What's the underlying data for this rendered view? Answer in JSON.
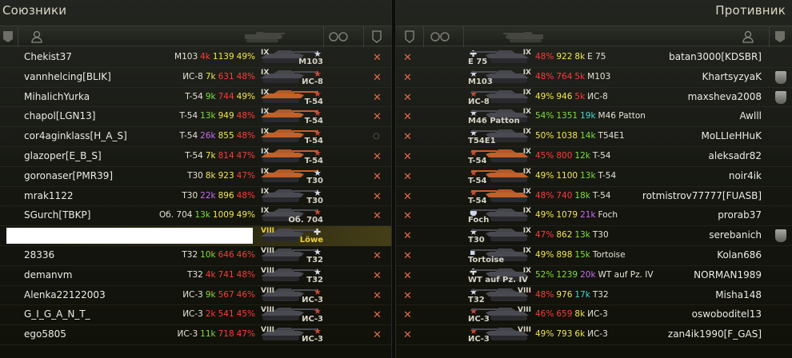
{
  "allies": {
    "title": "Союзники",
    "rows": [
      {
        "player": "Chekist37",
        "vehicle": "M103",
        "battles": "4k",
        "battles_color": "#ff3a3a",
        "rating": "1139",
        "rating_color": "#f2e84a",
        "winrate": "49%",
        "winrate_color": "#f2e84a",
        "tier": "IX",
        "nation": "usa",
        "tank_label": "M103",
        "status": "dead",
        "tank_color": "#4a4a52"
      },
      {
        "player": "vannhelcing[BLIK]",
        "vehicle": "ИС-8",
        "battles": "7k",
        "battles_color": "#f2e84a",
        "rating": "631",
        "rating_color": "#ff3a3a",
        "winrate": "48%",
        "winrate_color": "#ff3a3a",
        "tier": "IX",
        "nation": "ussr",
        "tank_label": "ИС-8",
        "status": "dead",
        "tank_color": "#4a4a52"
      },
      {
        "player": "MihalichYurka",
        "vehicle": "T-54",
        "battles": "9k",
        "battles_color": "#7dde3c",
        "rating": "744",
        "rating_color": "#ff3a3a",
        "winrate": "49%",
        "winrate_color": "#f2e84a",
        "tier": "IX",
        "nation": "ussr",
        "tank_label": "T-54",
        "status": "dead",
        "tank_color": "#c0622a"
      },
      {
        "player": "chapol[LGN13]",
        "vehicle": "T-54",
        "battles": "13k",
        "battles_color": "#7dde3c",
        "rating": "949",
        "rating_color": "#f2e84a",
        "winrate": "48%",
        "winrate_color": "#ff3a3a",
        "tier": "IX",
        "nation": "ussr",
        "tank_label": "T-54",
        "status": "dead",
        "tank_color": "#c0622a"
      },
      {
        "player": "cor4aginklass[H_A_S]",
        "vehicle": "T-54",
        "battles": "26k",
        "battles_color": "#c46bf0",
        "rating": "855",
        "rating_color": "#f2e84a",
        "winrate": "48%",
        "winrate_color": "#ff3a3a",
        "tier": "IX",
        "nation": "ussr",
        "tank_label": "T-54",
        "status": "alive",
        "tank_color": "#c0622a"
      },
      {
        "player": "glazoper[E_B_S]",
        "vehicle": "T-54",
        "battles": "7k",
        "battles_color": "#f2e84a",
        "rating": "814",
        "rating_color": "#ff3a3a",
        "winrate": "47%",
        "winrate_color": "#ff3a3a",
        "tier": "IX",
        "nation": "ussr",
        "tank_label": "T-54",
        "status": "dead",
        "tank_color": "#c0622a"
      },
      {
        "player": "goronaser[PMR39]",
        "vehicle": "T30",
        "battles": "8k",
        "battles_color": "#f2e84a",
        "rating": "923",
        "rating_color": "#f2e84a",
        "winrate": "47%",
        "winrate_color": "#ff3a3a",
        "tier": "IX",
        "nation": "usa",
        "tank_label": "T30",
        "status": "dead",
        "tank_color": "#c0622a"
      },
      {
        "player": "mrak1122",
        "vehicle": "T30",
        "battles": "22k",
        "battles_color": "#c46bf0",
        "rating": "896",
        "rating_color": "#f2e84a",
        "winrate": "48%",
        "winrate_color": "#ff3a3a",
        "tier": "IX",
        "nation": "usa",
        "tank_label": "T30",
        "status": "dead",
        "tank_color": "#4a4a52"
      },
      {
        "player": "SGurch[TBKP]",
        "vehicle": "Об. 704",
        "battles": "13k",
        "battles_color": "#7dde3c",
        "rating": "1009",
        "rating_color": "#f2e84a",
        "winrate": "49%",
        "winrate_color": "#f2e84a",
        "tier": "IX",
        "nation": "ussr",
        "tank_label": "Об. 704",
        "status": "dead",
        "tank_color": "#4a4a52"
      },
      {
        "player": "",
        "vehicle": "",
        "battles": "",
        "battles_color": "#f2e84a",
        "rating": "",
        "rating_color": "#f2e84a",
        "winrate": "",
        "winrate_color": "#f2e84a",
        "tier": "VIII",
        "nation": "germany",
        "tank_label": "Löwe",
        "status": "none",
        "tank_color": "#4a4a52",
        "self": true
      },
      {
        "player": "28336",
        "vehicle": "T32",
        "battles": "10k",
        "battles_color": "#7dde3c",
        "rating": "646",
        "rating_color": "#ff3a3a",
        "winrate": "46%",
        "winrate_color": "#ff3a3a",
        "tier": "VIII",
        "nation": "usa",
        "tank_label": "T32",
        "status": "dead",
        "tank_color": "#4a4a52"
      },
      {
        "player": "demanvm",
        "vehicle": "T32",
        "battles": "4k",
        "battles_color": "#ff3a3a",
        "rating": "741",
        "rating_color": "#ff3a3a",
        "winrate": "48%",
        "winrate_color": "#ff3a3a",
        "tier": "VIII",
        "nation": "usa",
        "tank_label": "T32",
        "status": "dead",
        "tank_color": "#4a4a52"
      },
      {
        "player": "Alenka22122003",
        "vehicle": "ИС-3",
        "battles": "9k",
        "battles_color": "#7dde3c",
        "rating": "567",
        "rating_color": "#ff3a3a",
        "winrate": "46%",
        "winrate_color": "#ff3a3a",
        "tier": "VIII",
        "nation": "ussr",
        "tank_label": "ИС-3",
        "status": "dead",
        "tank_color": "#4a4a52"
      },
      {
        "player": "G_I_G_A_N_T_",
        "vehicle": "ИС-3",
        "battles": "2k",
        "battles_color": "#ff3a3a",
        "rating": "541",
        "rating_color": "#ff3a3a",
        "winrate": "45%",
        "winrate_color": "#ff3a3a",
        "tier": "VIII",
        "nation": "ussr",
        "tank_label": "ИС-3",
        "status": "dead",
        "tank_color": "#4a4a52"
      },
      {
        "player": "ego5805",
        "vehicle": "ИС-3",
        "battles": "11k",
        "battles_color": "#7dde3c",
        "rating": "718",
        "rating_color": "#ff3a3a",
        "winrate": "47%",
        "winrate_color": "#ff3a3a",
        "tier": "VIII",
        "nation": "ussr",
        "tank_label": "ИС-3",
        "status": "dead",
        "tank_color": "#4a4a52"
      }
    ]
  },
  "enemies": {
    "title": "Противник",
    "rows": [
      {
        "player": "batan3000[KDSBR]",
        "vehicle": "E 75",
        "battles": "8k",
        "battles_color": "#f2e84a",
        "rating": "922",
        "rating_color": "#f2e84a",
        "winrate": "48%",
        "winrate_color": "#ff3a3a",
        "tier": "IX",
        "nation": "germany",
        "tank_label": "E 75",
        "status": "dead",
        "badge": false,
        "tank_color": "#4a4a52"
      },
      {
        "player": "KhartsyzyaK",
        "vehicle": "M103",
        "battles": "5k",
        "battles_color": "#ff3a3a",
        "rating": "764",
        "rating_color": "#ff3a3a",
        "winrate": "48%",
        "winrate_color": "#ff3a3a",
        "tier": "IX",
        "nation": "usa",
        "tank_label": "M103",
        "status": "dead",
        "badge": true,
        "tank_color": "#4a4a52"
      },
      {
        "player": "maxsheva2008",
        "vehicle": "ИС-8",
        "battles": "5k",
        "battles_color": "#ff3a3a",
        "rating": "946",
        "rating_color": "#f2e84a",
        "winrate": "49%",
        "winrate_color": "#f2e84a",
        "tier": "IX",
        "nation": "ussr",
        "tank_label": "ИС-8",
        "status": "dead",
        "badge": true,
        "tank_color": "#4a4a52"
      },
      {
        "player": "Awlll",
        "vehicle": "M46 Patton",
        "battles": "19k",
        "battles_color": "#46d6d0",
        "rating": "1351",
        "rating_color": "#7dde3c",
        "winrate": "54%",
        "winrate_color": "#7dde3c",
        "tier": "IX",
        "nation": "usa",
        "tank_label": "M46 Patton",
        "status": "dead",
        "badge": false,
        "tank_color": "#4a4a52"
      },
      {
        "player": "MoLLIeHHuK",
        "vehicle": "T54E1",
        "battles": "14k",
        "battles_color": "#7dde3c",
        "rating": "1038",
        "rating_color": "#f2e84a",
        "winrate": "50%",
        "winrate_color": "#f2e84a",
        "tier": "IX",
        "nation": "usa",
        "tank_label": "T54E1",
        "status": "dead",
        "badge": false,
        "tank_color": "#4a4a52"
      },
      {
        "player": "aleksadr82",
        "vehicle": "T-54",
        "battles": "12k",
        "battles_color": "#7dde3c",
        "rating": "800",
        "rating_color": "#ff3a3a",
        "winrate": "45%",
        "winrate_color": "#ff3a3a",
        "tier": "IX",
        "nation": "ussr",
        "tank_label": "T-54",
        "status": "dead",
        "badge": false,
        "tank_color": "#c0622a"
      },
      {
        "player": "noir4ik",
        "vehicle": "T-54",
        "battles": "13k",
        "battles_color": "#7dde3c",
        "rating": "1100",
        "rating_color": "#f2e84a",
        "winrate": "49%",
        "winrate_color": "#f2e84a",
        "tier": "IX",
        "nation": "ussr",
        "tank_label": "T-54",
        "status": "dead",
        "badge": false,
        "tank_color": "#c0622a"
      },
      {
        "player": "rotmistrov77777[FUASB]",
        "vehicle": "T-54",
        "battles": "18k",
        "battles_color": "#7dde3c",
        "rating": "740",
        "rating_color": "#ff3a3a",
        "winrate": "48%",
        "winrate_color": "#ff3a3a",
        "tier": "IX",
        "nation": "ussr",
        "tank_label": "T-54",
        "status": "dead",
        "badge": false,
        "tank_color": "#c0622a"
      },
      {
        "player": "prorab37",
        "vehicle": "Foch",
        "battles": "21k",
        "battles_color": "#c46bf0",
        "rating": "1079",
        "rating_color": "#f2e84a",
        "winrate": "49%",
        "winrate_color": "#f2e84a",
        "tier": "IX",
        "nation": "france",
        "tank_label": "Foch",
        "status": "dead",
        "badge": false,
        "tank_color": "#4a4a52"
      },
      {
        "player": "serebanich",
        "vehicle": "T30",
        "battles": "13k",
        "battles_color": "#7dde3c",
        "rating": "862",
        "rating_color": "#f2e84a",
        "winrate": "47%",
        "winrate_color": "#ff3a3a",
        "tier": "IX",
        "nation": "usa",
        "tank_label": "T30",
        "status": "dead",
        "badge": true,
        "tank_color": "#4a4a52"
      },
      {
        "player": "Kolan686",
        "vehicle": "Tortoise",
        "battles": "15k",
        "battles_color": "#7dde3c",
        "rating": "898",
        "rating_color": "#f2e84a",
        "winrate": "49%",
        "winrate_color": "#f2e84a",
        "tier": "IX",
        "nation": "uk",
        "tank_label": "Tortoise",
        "status": "dead",
        "badge": false,
        "tank_color": "#4a4a52"
      },
      {
        "player": "NORMAN1989",
        "vehicle": "WT auf Pz. IV",
        "battles": "20k",
        "battles_color": "#c46bf0",
        "rating": "1239",
        "rating_color": "#7dde3c",
        "winrate": "52%",
        "winrate_color": "#7dde3c",
        "tier": "IX",
        "nation": "germany",
        "tank_label": "WT auf Pz. IV",
        "status": "dead",
        "badge": false,
        "tank_color": "#4a4a52"
      },
      {
        "player": "Misha148",
        "vehicle": "T32",
        "battles": "17k",
        "battles_color": "#46d6d0",
        "rating": "976",
        "rating_color": "#f2e84a",
        "winrate": "48%",
        "winrate_color": "#ff3a3a",
        "tier": "VIII",
        "nation": "usa",
        "tank_label": "T32",
        "status": "dead",
        "badge": false,
        "tank_color": "#4a4a52"
      },
      {
        "player": "oswoboditel13",
        "vehicle": "ИС-3",
        "battles": "8k",
        "battles_color": "#f2e84a",
        "rating": "659",
        "rating_color": "#ff3a3a",
        "winrate": "46%",
        "winrate_color": "#ff3a3a",
        "tier": "VIII",
        "nation": "ussr",
        "tank_label": "ИС-3",
        "status": "dead",
        "badge": false,
        "tank_color": "#4a4a52"
      },
      {
        "player": "zan4ik1990[F_GAS]",
        "vehicle": "ИС-3",
        "battles": "6k",
        "battles_color": "#f2e84a",
        "rating": "793",
        "rating_color": "#f2e84a",
        "winrate": "49%",
        "winrate_color": "#f2e84a",
        "tier": "VIII",
        "nation": "ussr",
        "tank_label": "ИС-3",
        "status": "dead",
        "badge": false,
        "tank_color": "#4a4a52"
      }
    ]
  },
  "icons": {
    "dead": "✕",
    "alive": "○"
  },
  "colors": {
    "accent_self": "#f0d23c",
    "dead_mark": "#e06a4a"
  }
}
